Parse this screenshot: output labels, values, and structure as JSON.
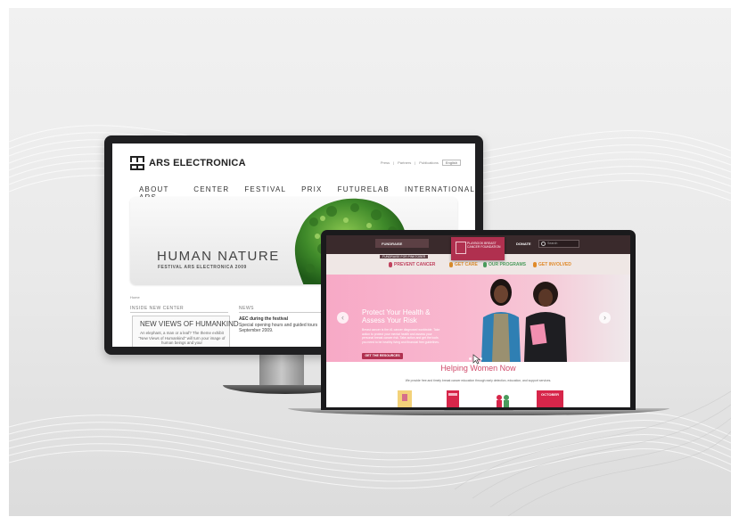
{
  "monitor_site": {
    "brand": "ARS ELECTRONICA",
    "top_links": [
      "Press",
      "Partners",
      "Publications"
    ],
    "language": "English",
    "nav": [
      "ABOUT ARS",
      "CENTER",
      "FESTIVAL",
      "PRIX",
      "FUTURELAB",
      "INTERNATIONAL"
    ],
    "banner_title": "HUMAN NATURE",
    "banner_subtitle": "FESTIVAL ARS ELECTRONICA 2009",
    "breadcrumb": "Home",
    "section_left": "INSIDE NEW CENTER",
    "section_right": "NEWS",
    "feature_title": "NEW VIEWS OF HUMANKIND",
    "feature_text": "An elephant, a man or a leaf? The theme exhibit \"New Views of Humankind\" will turn your image of human beings and your",
    "news_title": "AEC during the festival",
    "news_text": "Special opening hours and guided tours September 2009."
  },
  "laptop_site": {
    "fundraise": "FUNDRAISE",
    "sub_link": "FUNDRAISE FOR PINKTOBER",
    "logo_text": "PLAYBOOK BREAST CANCER FOUNDATION",
    "donate": "DONATE",
    "search_placeholder": "Search",
    "nav": [
      "PREVENT CANCER",
      "GET CARE",
      "OUR PROGRAMS",
      "GET INVOLVED"
    ],
    "nav_colors": [
      "#c0435f",
      "#d68a2c",
      "#4a9b5c",
      "#e08a2a"
    ],
    "hero_title": "Protect Your Health & Assess Your Risk",
    "hero_text": "Breast cancer is the #1 cancer diagnosed worldwide. Take action to protect your mental health and assess your personal breast cancer risk. Take action and get the tools you need to be healthy living and financial free guidelines.",
    "hero_button": "GET THE RESOURCES",
    "helping_title": "Helping Women Now",
    "helping_text": "We provide free and timely breast cancer education through early detection, education, and support services.",
    "october_badge": "OCTOBER"
  }
}
